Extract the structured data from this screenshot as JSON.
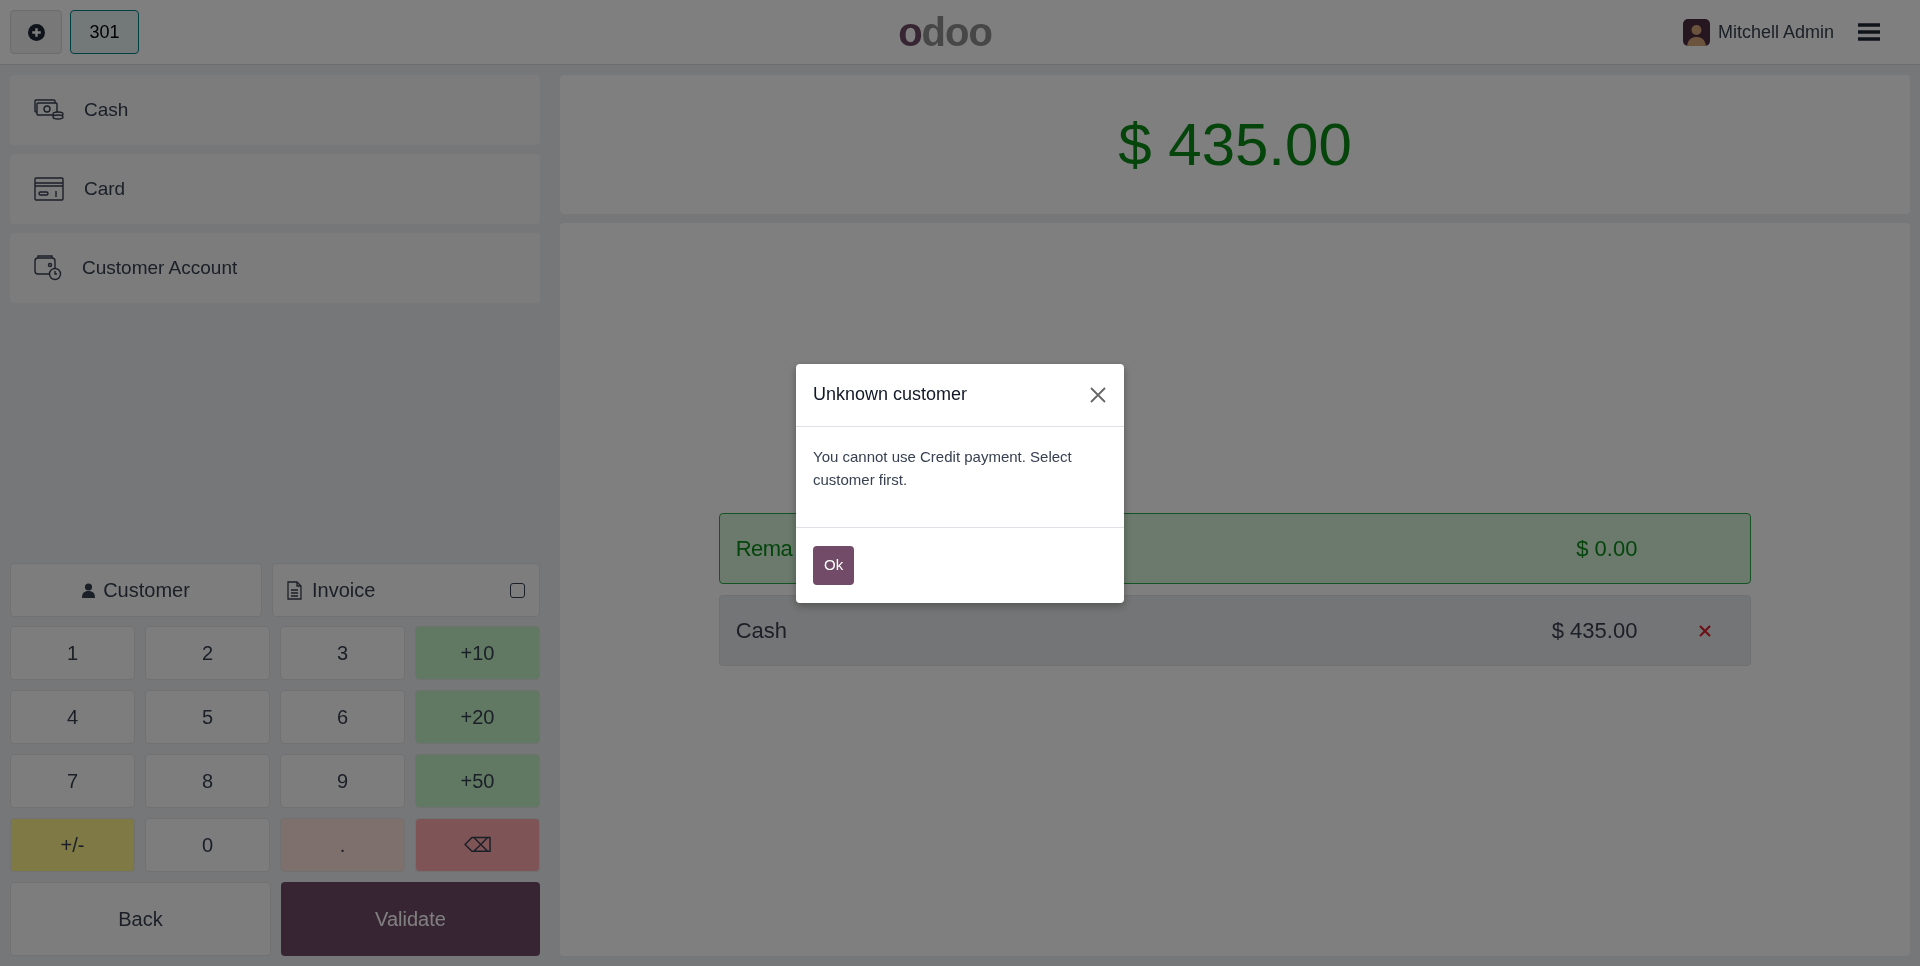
{
  "topbar": {
    "order_tabs": [
      {
        "label": "301",
        "selected": true
      }
    ],
    "logo": "odoo",
    "user": "Mitchell Admin"
  },
  "payment_methods": [
    {
      "name": "Cash",
      "kind": "cash"
    },
    {
      "name": "Card",
      "kind": "card"
    },
    {
      "name": "Customer Account",
      "kind": "account"
    }
  ],
  "customer_button": "Customer",
  "invoice": {
    "label": "Invoice",
    "checked": false
  },
  "numpad": [
    {
      "label": "1",
      "kind": "digit"
    },
    {
      "label": "2",
      "kind": "digit"
    },
    {
      "label": "3",
      "kind": "digit"
    },
    {
      "label": "+10",
      "kind": "add"
    },
    {
      "label": "4",
      "kind": "digit"
    },
    {
      "label": "5",
      "kind": "digit"
    },
    {
      "label": "6",
      "kind": "digit"
    },
    {
      "label": "+20",
      "kind": "add"
    },
    {
      "label": "7",
      "kind": "digit"
    },
    {
      "label": "8",
      "kind": "digit"
    },
    {
      "label": "9",
      "kind": "digit"
    },
    {
      "label": "+50",
      "kind": "add"
    },
    {
      "label": "+/-",
      "kind": "sign"
    },
    {
      "label": "0",
      "kind": "digit"
    },
    {
      "label": ".",
      "kind": "decimal"
    },
    {
      "label": "⌫",
      "kind": "backspace"
    }
  ],
  "back_button": "Back",
  "validate_button": "Validate",
  "total": "$ 435.00",
  "remaining": {
    "label": "Rema",
    "amount": "$ 0.00"
  },
  "payment_lines": [
    {
      "name": "Cash",
      "amount": "$ 435.00"
    }
  ],
  "dialog": {
    "title": "Unknown customer",
    "body": "You cannot use Credit payment. Select customer first.",
    "button": "Ok"
  }
}
